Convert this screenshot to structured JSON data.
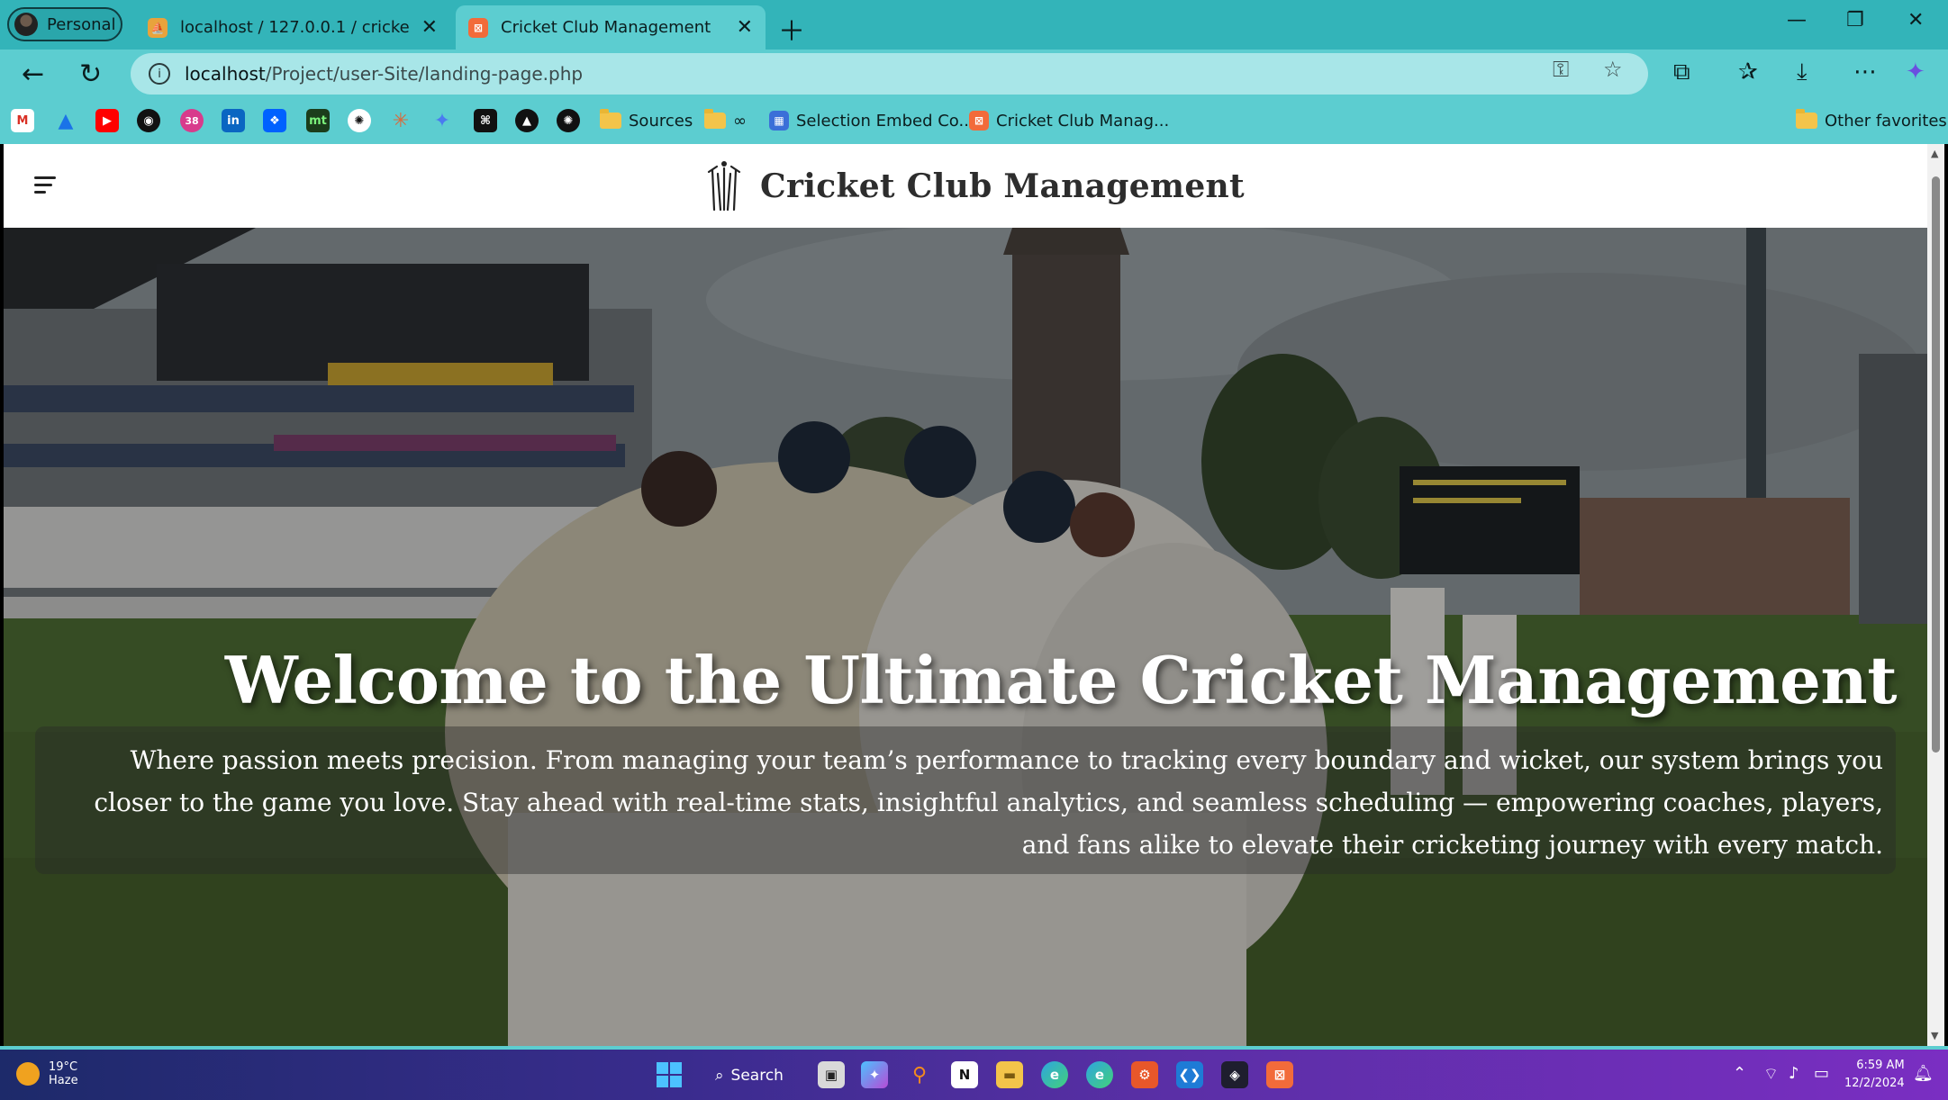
{
  "browser": {
    "profile_label": "Personal",
    "tabs": [
      {
        "label": "localhost / 127.0.0.1 / cricket-club",
        "active": false
      },
      {
        "label": "Cricket Club Management",
        "active": true
      }
    ],
    "url_host": "localhost",
    "url_path": "/Project/user-Site/landing-page.php",
    "bookmarks": [
      {
        "label": "Sources",
        "type": "folder"
      },
      {
        "label": "∞",
        "type": "folder"
      },
      {
        "label": "Selection Embed Co...",
        "type": "link"
      },
      {
        "label": "Cricket Club Manag...",
        "type": "link"
      }
    ],
    "other_favorites": "Other favorites",
    "tab_count_badge": "38"
  },
  "site": {
    "title": "Cricket Club Management",
    "hero_title": "Welcome to the Ultimate Cricket Management",
    "hero_text": "Where passion meets precision. From managing your team’s performance to tracking every boundary and wicket, our system brings you closer to the game you love. Stay ahead with real-time stats, insightful analytics, and seamless scheduling — empowering coaches, players, and fans alike to elevate their cricketing journey with every match."
  },
  "taskbar": {
    "temperature": "19°C",
    "weather_desc": "Haze",
    "search_label": "Search",
    "time": "6:59 AM",
    "date": "12/2/2024"
  },
  "colors": {
    "chrome": "#5ccdd0",
    "tabstrip": "#33b4b9",
    "omnibox": "#a8e6e8"
  }
}
